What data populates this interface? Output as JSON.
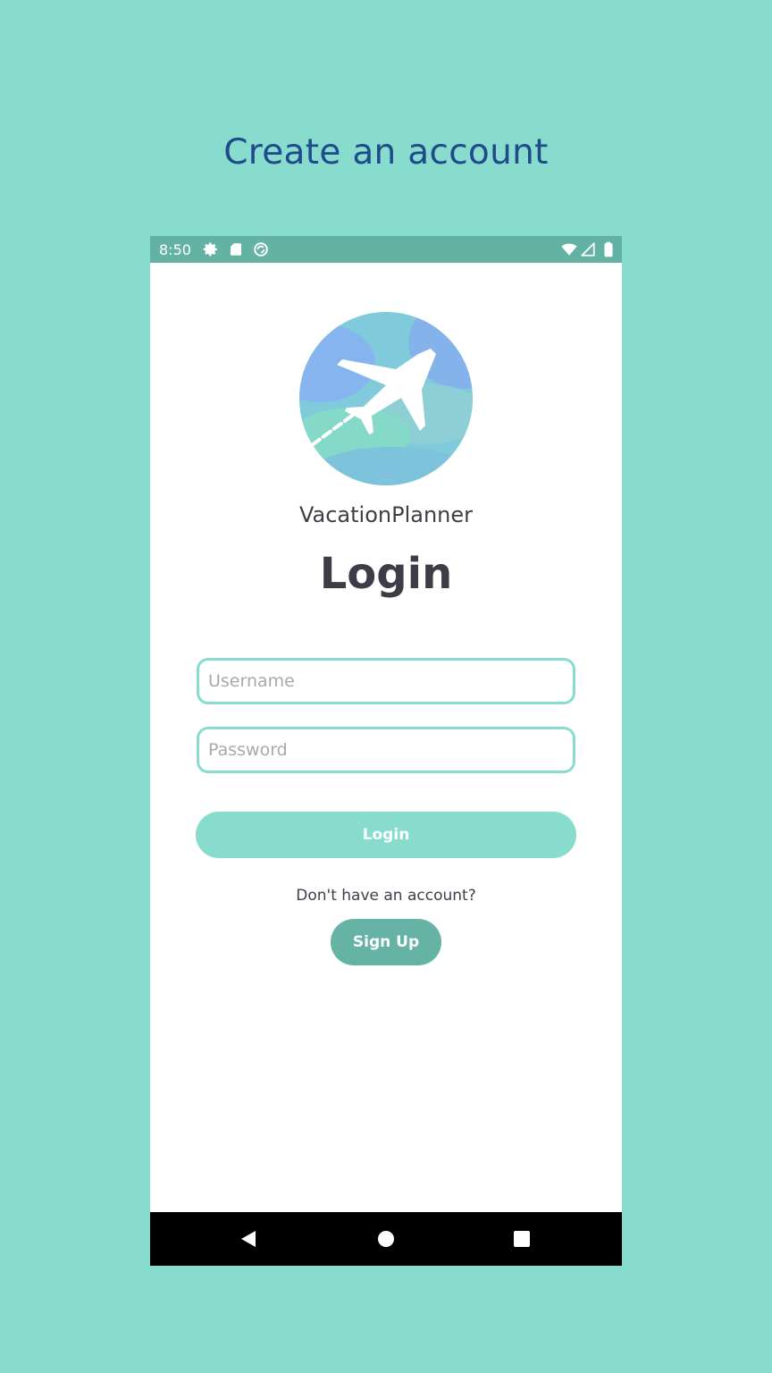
{
  "page": {
    "headline": "Create an account"
  },
  "status_bar": {
    "time": "8:50",
    "left_icons": [
      "gear-icon",
      "sd-card-icon",
      "sync-icon"
    ],
    "right_icons": [
      "wifi-icon",
      "signal-icon",
      "battery-icon"
    ]
  },
  "app": {
    "name": "VacationPlanner",
    "logo_icon": "airplane-icon"
  },
  "login_form": {
    "title": "Login",
    "username_placeholder": "Username",
    "username_value": "",
    "password_placeholder": "Password",
    "password_value": "",
    "login_button_label": "Login",
    "no_account_text": "Don't have an account?",
    "signup_button_label": "Sign Up"
  },
  "nav_bar": {
    "items": [
      "back-icon",
      "home-icon",
      "recents-icon"
    ]
  },
  "colors": {
    "background": "#87dccd",
    "headline": "#1f4a8c",
    "status_bar": "#64b2a4",
    "field_border": "#88dccd",
    "login_button": "#88dccd",
    "signup_button": "#65b3a5",
    "title_text": "#3c3d47"
  }
}
